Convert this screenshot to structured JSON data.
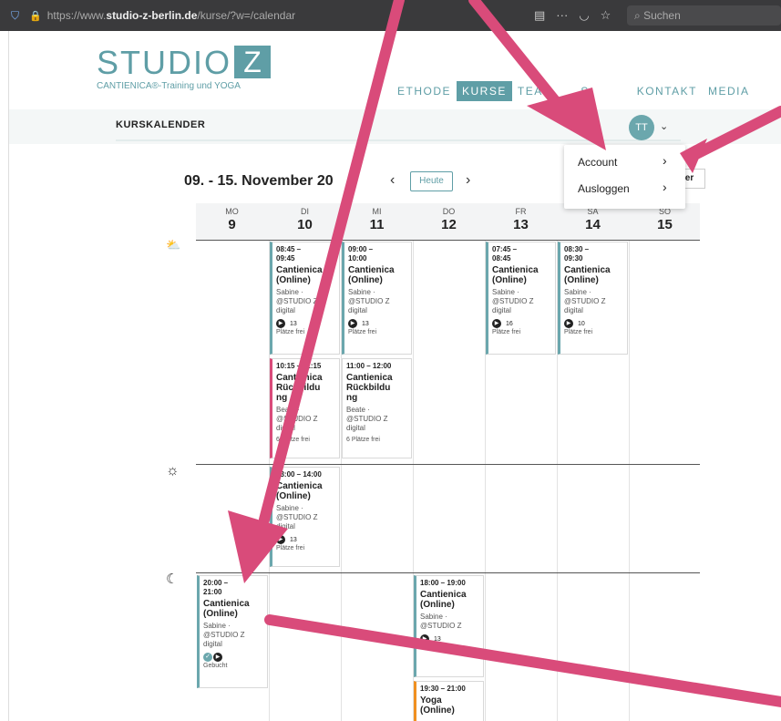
{
  "browser": {
    "url_prefix": "https://www.",
    "url_domain": "studio-z-berlin.de",
    "url_path": "/kurse/?w=/calendar",
    "search_placeholder": "Suchen"
  },
  "header": {
    "logo_text": "STUDIO",
    "logo_letter": "Z",
    "logo_sub": "CANTIENICA®-Training und YOGA",
    "nav": [
      "ETHODE",
      "KURSE",
      "TEAM",
      "S",
      "KONTAKT",
      "MEDIA"
    ]
  },
  "subnav": {
    "title": "KURSKALENDER",
    "avatar": "TT"
  },
  "dropdown": {
    "items": [
      "Account",
      "Ausloggen"
    ]
  },
  "calendar": {
    "range": "09. - 15. November 20",
    "range_end": "0",
    "today_label": "Heute",
    "filter_label": "Filter",
    "days": [
      {
        "wd": "MO",
        "dn": "9"
      },
      {
        "wd": "DI",
        "dn": "10"
      },
      {
        "wd": "MI",
        "dn": "11"
      },
      {
        "wd": "DO",
        "dn": "12"
      },
      {
        "wd": "FR",
        "dn": "13"
      },
      {
        "wd": "SA",
        "dn": "14"
      },
      {
        "wd": "SO",
        "dn": "15"
      }
    ],
    "events": [
      {
        "time": "08:45 –\n09:45",
        "title": "Cantienica\n(Online)",
        "who": "Sabine ·\n@STUDIO Z\ndigital",
        "seats": "13",
        "free": "Plätze frei"
      },
      {
        "time": "09:00 –\n10:00",
        "title": "Cantienica\n(Online)",
        "who": "Sabine ·\n@STUDIO Z\ndigital",
        "seats": "13",
        "free": "Plätze frei"
      },
      {
        "time": "07:45 –\n08:45",
        "title": "Cantienica\n(Online)",
        "who": "Sabine ·\n@STUDIO Z\ndigital",
        "seats": "16",
        "free": "Plätze frei"
      },
      {
        "time": "08:30 –\n09:30",
        "title": "Cantienica\n(Online)",
        "who": "Sabine ·\n@STUDIO Z\ndigital",
        "seats": "10",
        "free": "Plätze frei"
      },
      {
        "time": "10:15 – 11:15",
        "title": "Cantienica\nRückbildu\nng",
        "who": "Beate ·\n@STUDIO Z\ndigital",
        "free": "6 Plätze frei"
      },
      {
        "time": "11:00 – 12:00",
        "title": "Cantienica\nRückbildu\nng",
        "who": "Beate ·\n@STUDIO Z\ndigital",
        "free": "6 Plätze frei"
      },
      {
        "time": "13:00 – 14:00",
        "title": "Cantienica\n(Online)",
        "who": "Sabine ·\n@STUDIO Z\ndigital",
        "seats": "13",
        "free": "Plätze frei"
      },
      {
        "time": "20:00 –\n21:00",
        "title": "Cantienica\n(Online)",
        "who": "Sabine ·\n@STUDIO Z\ndigital",
        "free": "Gebucht"
      },
      {
        "time": "18:00 – 19:00",
        "title": "Cantienica\n(Online)",
        "who": "Sabine ·\n@STUDIO Z",
        "seats": "13",
        "free": "Plätze frei"
      },
      {
        "time": "19:30 – 21:00",
        "title": "Yoga\n(Online)"
      }
    ]
  },
  "colors": {
    "brand": "#5f9ea6",
    "annotation": "#d94b7a",
    "event_accent": "#6ba7ad",
    "event_pink": "#d94b7a",
    "event_orange": "#f09020"
  }
}
